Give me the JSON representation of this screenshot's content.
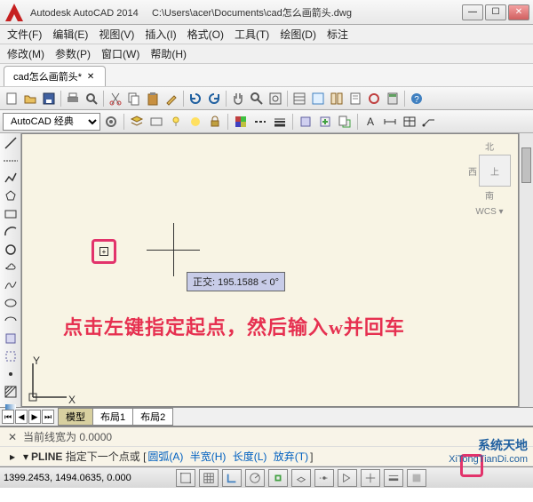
{
  "title": {
    "app": "Autodesk AutoCAD 2014",
    "path": "C:\\Users\\acer\\Documents\\cad怎么画箭头.dwg"
  },
  "menus": {
    "row1": [
      "文件(F)",
      "编辑(E)",
      "视图(V)",
      "插入(I)",
      "格式(O)",
      "工具(T)",
      "绘图(D)",
      "标注"
    ],
    "row2": [
      "修改(M)",
      "参数(P)",
      "窗口(W)",
      "帮助(H)"
    ]
  },
  "tab": {
    "name": "cad怎么画箭头*"
  },
  "workspace": {
    "selected": "AutoCAD 经典"
  },
  "viewcube": {
    "north": "北",
    "top": "上",
    "west": "西",
    "south": "南",
    "wcs": "WCS"
  },
  "tooltip": {
    "text": "正交: 195.1588 < 0°"
  },
  "annotation": {
    "text": "点击左键指定起点，然后输入w并回车"
  },
  "ucs": {
    "x": "X",
    "y": "Y"
  },
  "layout": {
    "tabs": [
      "模型",
      "布局1",
      "布局2"
    ]
  },
  "command": {
    "history": "当前线宽为  0.0000",
    "prompt_icon": "▸",
    "prompt_cmd": "PLINE",
    "prompt_text": "指定下一个点或",
    "opts": [
      "圆弧(A)",
      "半宽(H)",
      "长度(L)",
      "放弃(T)"
    ]
  },
  "status": {
    "coords": "1399.2453, 1494.0635, 0.000"
  },
  "watermark": {
    "line1": "系统天地",
    "line2": "XiTongTianDi.com"
  }
}
